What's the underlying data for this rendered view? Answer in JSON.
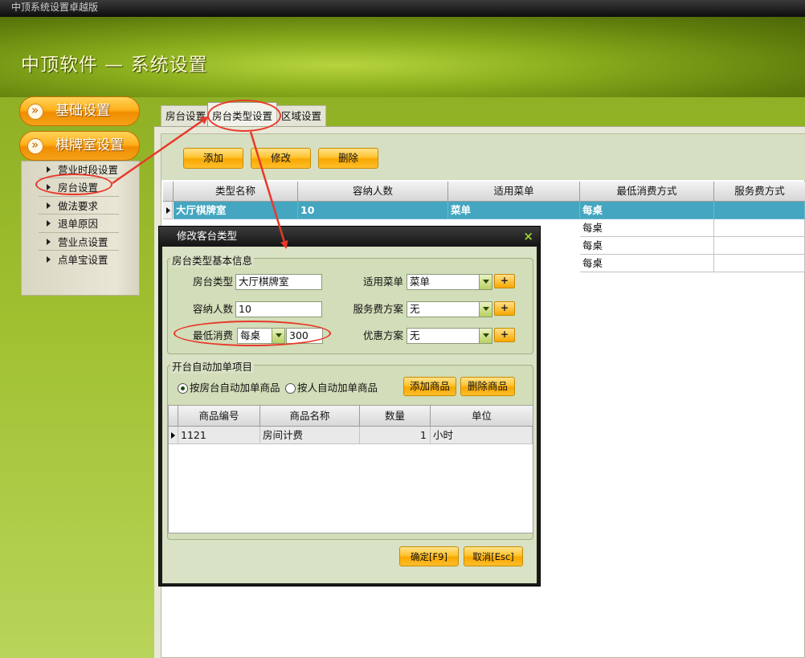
{
  "window": {
    "title": "中顶系统设置卓越版"
  },
  "header": {
    "title": "中顶软件 — 系统设置"
  },
  "nav": {
    "sections": [
      {
        "label": "基础设置"
      },
      {
        "label": "棋牌室设置"
      }
    ],
    "items": [
      {
        "label": "营业时段设置"
      },
      {
        "label": "房台设置"
      },
      {
        "label": "做法要求"
      },
      {
        "label": "退单原因"
      },
      {
        "label": "营业点设置"
      },
      {
        "label": "点单宝设置"
      }
    ]
  },
  "tabs": [
    {
      "label": "房台设置"
    },
    {
      "label": "房台类型设置"
    },
    {
      "label": "区域设置"
    }
  ],
  "toolbar": {
    "add": "添加",
    "edit": "修改",
    "delete": "删除"
  },
  "grid": {
    "columns": [
      "类型名称",
      "容纳人数",
      "适用菜单",
      "最低消费方式",
      "服务费方式"
    ],
    "rows": [
      {
        "name": "大厅棋牌室",
        "capacity": "10",
        "menu": "菜单",
        "min_mode": "每桌",
        "service": ""
      },
      {
        "name": "",
        "capacity": "",
        "menu": "",
        "min_mode": "每桌",
        "service": ""
      },
      {
        "name": "",
        "capacity": "",
        "menu": "",
        "min_mode": "每桌",
        "service": ""
      },
      {
        "name": "",
        "capacity": "",
        "menu": "",
        "min_mode": "每桌",
        "service": ""
      }
    ]
  },
  "dialog": {
    "title": "修改客台类型",
    "basic_group": "房台类型基本信息",
    "room_type_label": "房台类型",
    "room_type_value": "大厅棋牌室",
    "capacity_label": "容纳人数",
    "capacity_value": "10",
    "min_label": "最低消费",
    "min_mode": "每桌",
    "min_amount": "300",
    "menu_label": "适用菜单",
    "menu_value": "菜单",
    "service_label": "服务费方案",
    "service_value": "无",
    "discount_label": "优惠方案",
    "discount_value": "无",
    "auto_group": "开台自动加单项目",
    "radio_room": "按房台自动加单商品",
    "radio_person": "按人自动加单商品",
    "add_goods": "添加商品",
    "delete_goods": "删除商品",
    "sub_columns": [
      "商品编号",
      "商品名称",
      "数量",
      "单位"
    ],
    "sub_rows": [
      {
        "code": "1121",
        "name": "房间计费",
        "qty": "1",
        "unit": "小时"
      }
    ],
    "ok": "确定[F9]",
    "cancel": "取消[Esc]"
  },
  "colors": {
    "accent_orange": "#f8a800",
    "selected_row": "#44a6c0",
    "annotation_red": "#e8392a"
  }
}
